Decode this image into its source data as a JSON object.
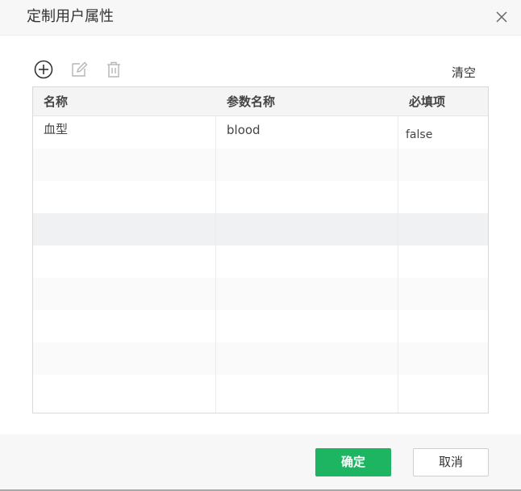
{
  "dialog": {
    "title": "定制用户属性"
  },
  "toolbar": {
    "add_icon": "plus-circle-icon",
    "edit_icon": "edit-icon",
    "delete_icon": "trash-icon",
    "clear_label": "清空"
  },
  "table": {
    "headers": {
      "name": "名称",
      "param": "参数名称",
      "required": "必填项"
    },
    "rows": [
      {
        "name": "血型",
        "param": "blood",
        "required": "false"
      }
    ]
  },
  "footer": {
    "ok_label": "确定",
    "cancel_label": "取消"
  },
  "colors": {
    "accent": "#1eb562",
    "header_bg": "#f7f7f7",
    "selected_row": "#f0f1f3"
  }
}
